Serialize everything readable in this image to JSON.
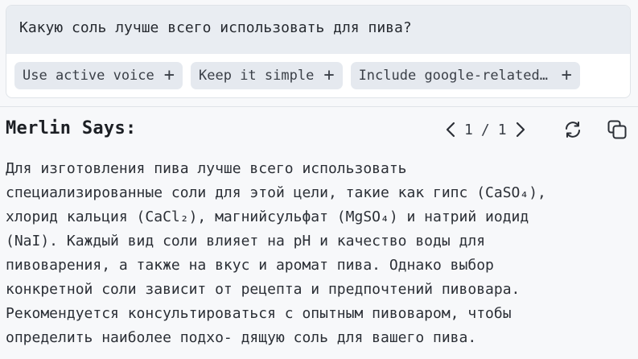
{
  "prompt": {
    "text": "Какую соль лучше всего использовать для пива?"
  },
  "chips": [
    {
      "label": "Use active voice",
      "icon": "plus-icon"
    },
    {
      "label": "Keep it simple",
      "icon": "plus-icon"
    },
    {
      "label": "Include google-related…",
      "icon": "plus-icon"
    }
  ],
  "answer": {
    "title": "Merlin Says:",
    "pager": {
      "current": "1",
      "separator": "/",
      "total": "1"
    },
    "lines": [
      "Для изготовления пива лучше всего использовать",
      "специализированные соли для этой цели, такие как гипс (CaSO₄),",
      "хлорид кальция (CaCl₂), магнийсульфат (MgSO₄) и натрий иодид",
      "(NaI). Каждый вид соли влияет на pH и качество воды для",
      "пивоварения, а также на вкус и аромат пива. Однако выбор",
      "конкретной соли зависит от рецепта и предпочтений пивовара.",
      "Рекомендуется консультироваться с опытным пивоваром, чтобы",
      "определить наиболее подхо- дящую соль для вашего пива."
    ]
  },
  "icons": [
    "chevron-left-icon",
    "chevron-right-icon",
    "refresh-icon",
    "copy-icon",
    "plus-icon"
  ],
  "colors": {
    "background": "#f7f8fa",
    "prompt_bg": "#e9edf2",
    "chip_bg": "#e5e9ef",
    "text": "#2b2f36"
  }
}
